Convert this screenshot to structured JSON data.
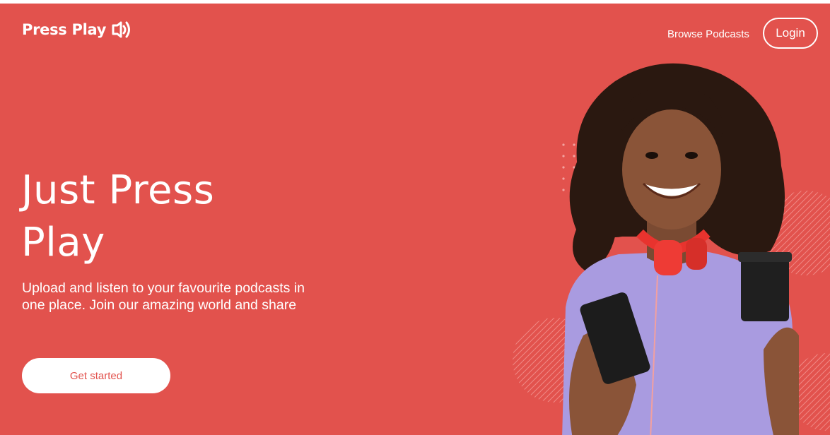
{
  "brand": {
    "name": "Press Play",
    "logo_icon": "sound-waves-icon"
  },
  "nav": {
    "browse_label": "Browse Podcasts",
    "login_label": "Login"
  },
  "hero": {
    "headline": "Just Press Play",
    "subtitle": "Upload and listen to your favourite podcasts in one place. Join our amazing world and share",
    "cta_label": "Get started"
  },
  "colors": {
    "background": "#e2524d",
    "text": "#ffffff",
    "shirt": "#a99be0",
    "headphones": "#e8332e"
  }
}
